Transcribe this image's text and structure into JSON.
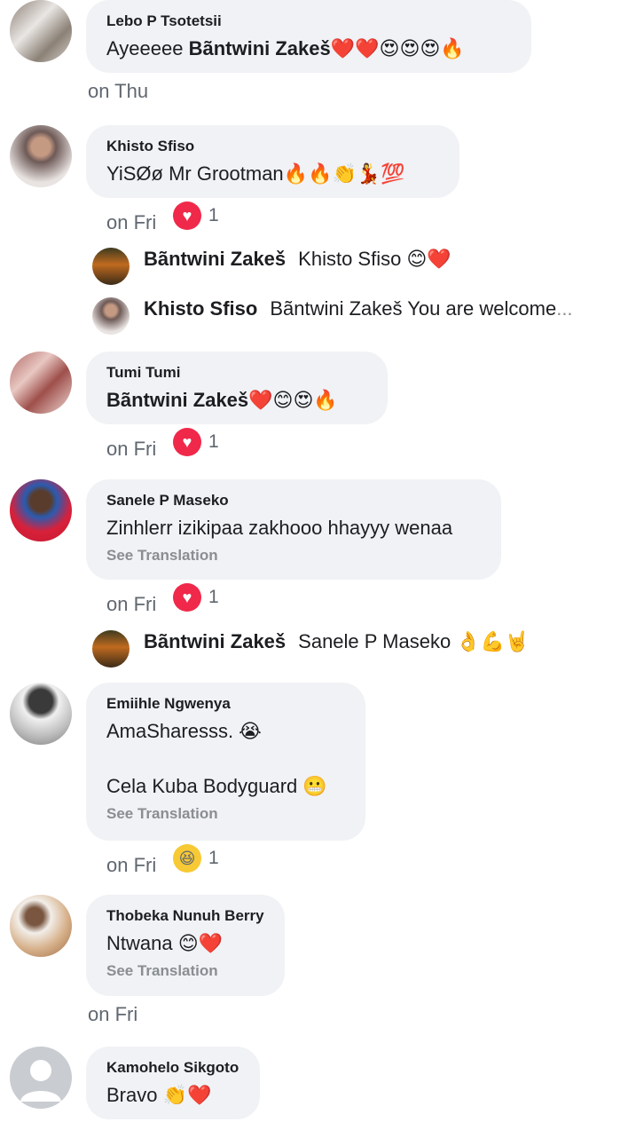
{
  "comments": [
    {
      "author": "Lebo P Tsotetsii",
      "text_pre": "Ayeeeee ",
      "text_bold": "Bãntwini Zakeš",
      "emoji": "❤️❤️😍😍😍🔥",
      "time": "on Thu"
    },
    {
      "author": "Khisto Sfiso",
      "text": "YiSØø Mr Grootman",
      "emoji": "🔥🔥👏💃💯",
      "time": "on Fri",
      "reaction_count": "1"
    },
    {
      "author": "Tumi Tumi",
      "text_bold": "Bãntwini Zakeš",
      "emoji": "❤️😊😍🔥",
      "time": "on Fri",
      "reaction_count": "1"
    },
    {
      "author": "Sanele P Maseko",
      "text": "Zinhlerr izikipaa zakhooo hhayyy wenaa",
      "see_translation": "See Translation",
      "time": "on Fri",
      "reaction_count": "1"
    },
    {
      "author": "Emiihle Ngwenya",
      "text_line1": "AmaSharesss. 😭",
      "text_line2": "Cela Kuba Bodyguard 😬",
      "see_translation": "See Translation",
      "time": "on Fri",
      "reaction_count": "1"
    },
    {
      "author": "Thobeka Nunuh Berry",
      "text": "Ntwana ",
      "emoji": "😊❤️",
      "see_translation": "See Translation",
      "time": "on Fri"
    },
    {
      "author": "Kamohelo Sikgoto",
      "text": "Bravo ",
      "emoji": "👏❤️"
    }
  ],
  "replies": [
    {
      "author": "Bãntwini Zakeš",
      "text": "Khisto Sfiso 😊❤️"
    },
    {
      "author": "Khisto Sfiso",
      "text": "Bãntwini Zakeš You are welcome",
      "ellipsis": "..."
    },
    {
      "author": "Bãntwini Zakeš",
      "text": "Sanele P Maseko 👌💪🤘"
    }
  ],
  "icons": {
    "love_reaction": "heart-reaction-icon",
    "haha_reaction": "laugh-reaction-icon"
  },
  "colors": {
    "bubble": "#f0f2f5",
    "love": "#f0284a",
    "haha": "#f7c935",
    "meta": "#606770"
  }
}
